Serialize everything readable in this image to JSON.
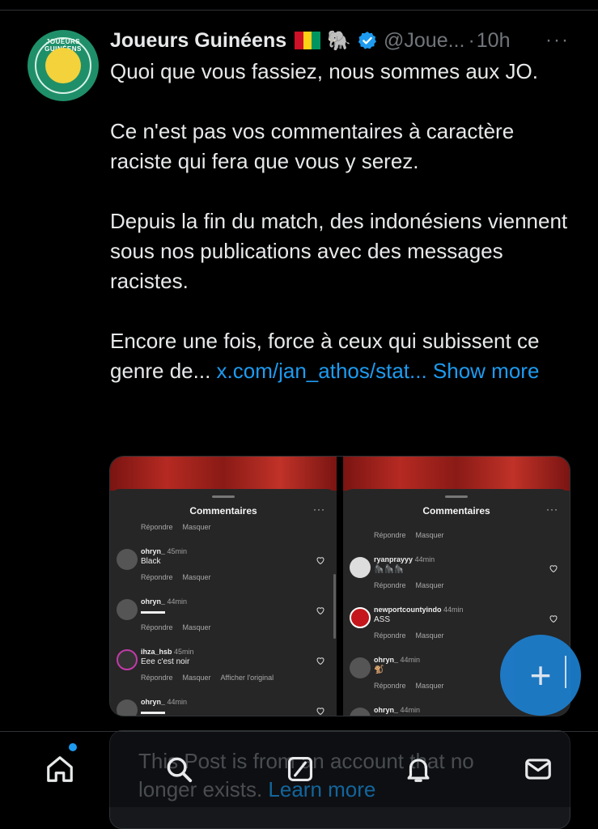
{
  "post": {
    "author_name": "Joueurs Guinéens",
    "avatar_text": "JOUEURS GUINÉENS",
    "flag_emoji": "🇬🇳",
    "emoji": "🐘",
    "handle": "@Joue...",
    "separator": "·",
    "time": "10h",
    "more": "···",
    "paragraphs": [
      "Quoi que vous fassiez, nous sommes aux JO.",
      "Ce n'est pas vos commentaires à caractère raciste qui fera que vous y serez.",
      "Depuis la fin du match, des indonésiens viennent sous nos publications avec des messages racistes."
    ],
    "last_paragraph_prefix": "Encore une fois, force à ceux qui subissent ce genre de... ",
    "link_text": "x.com/jan_athos/stat...",
    "show_more": "Show more"
  },
  "media": {
    "left": {
      "title": "Commentaires",
      "dots": "···",
      "top_actions": [
        "Répondre",
        "Masquer"
      ],
      "comments": [
        {
          "user": "ohryn_",
          "time": "45min",
          "text": "Black",
          "actions": [
            "Répondre",
            "Masquer"
          ]
        },
        {
          "user": "ohryn_",
          "time": "44min",
          "text": "▬▬▬",
          "actions": [
            "Répondre",
            "Masquer"
          ]
        },
        {
          "user": "ihza_hsb",
          "time": "45min",
          "text": "Eee c'est noir",
          "actions": [
            "Répondre",
            "Masquer",
            "Afficher l'original"
          ]
        },
        {
          "user": "ohryn_",
          "time": "44min",
          "text": "▬▬▬",
          "actions": []
        }
      ]
    },
    "right": {
      "title": "Commentaires",
      "dots": "···",
      "top_actions": [
        "Répondre",
        "Masquer"
      ],
      "comments": [
        {
          "user": "ryanprayyy",
          "time": "44min",
          "text": "🦍🦍🦍",
          "actions": [
            "Répondre",
            "Masquer"
          ]
        },
        {
          "user": "newportcountyindo",
          "time": "44min",
          "text": "ASS",
          "actions": [
            "Répondre",
            "Masquer"
          ]
        },
        {
          "user": "ohryn_",
          "time": "44min",
          "text": "🐒",
          "actions": [
            "Répondre",
            "Masquer"
          ]
        },
        {
          "user": "ohryn_",
          "time": "44min",
          "text": "",
          "actions": []
        }
      ]
    }
  },
  "fab": {
    "label": "+"
  },
  "notice": {
    "text": "This Post is from an account that no longer exists.",
    "link": "Learn more"
  },
  "colors": {
    "accent": "#1d9bf0",
    "background": "#000000",
    "muted_text": "#71767b",
    "text": "#e7e9ea"
  },
  "nav": [
    "home-icon",
    "search-icon",
    "grok-icon",
    "bell-icon",
    "mail-icon"
  ]
}
